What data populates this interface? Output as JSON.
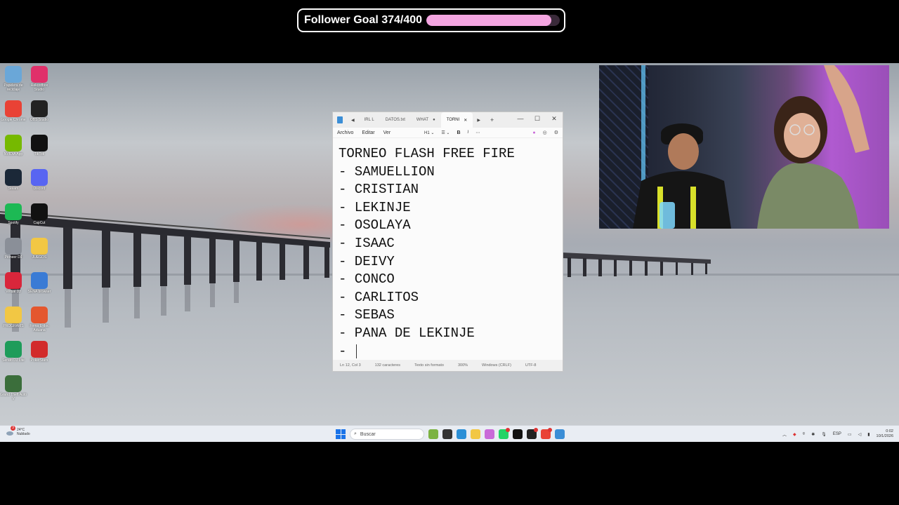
{
  "overlay": {
    "follower_label": "Follower Goal 374/400",
    "current": 374,
    "goal": 400,
    "fill_color": "#f3a4e0"
  },
  "desktop_icons": [
    {
      "label": "Papelera de reciclaje",
      "icon": "recycle-bin-icon",
      "color": "#6aa7d8"
    },
    {
      "label": "Rekordbox Studio",
      "icon": "music-app-icon",
      "color": "#e0306a"
    },
    {
      "label": "Google Chrome",
      "icon": "chrome-icon",
      "color": "#e94235"
    },
    {
      "label": "OBS Studio",
      "icon": "obs-icon",
      "color": "#222222"
    },
    {
      "label": "NVIDIA App",
      "icon": "nvidia-icon",
      "color": "#76b900"
    },
    {
      "label": "TikTok",
      "icon": "tiktok-icon",
      "color": "#111111"
    },
    {
      "label": "Steam",
      "icon": "steam-icon",
      "color": "#1b2838"
    },
    {
      "label": "Discord",
      "icon": "discord-icon",
      "color": "#5865f2"
    },
    {
      "label": "Spotify",
      "icon": "spotify-icon",
      "color": "#1db954"
    },
    {
      "label": "CapCut",
      "icon": "capcut-icon",
      "color": "#111111"
    },
    {
      "label": "Pioneer DJ",
      "icon": "pioneer-icon",
      "color": "#8a8f98"
    },
    {
      "label": "JUEGOS",
      "icon": "folder-icon",
      "color": "#f2c744"
    },
    {
      "label": "Virtual DJ",
      "icon": "virtualdj-icon",
      "color": "#d9263b"
    },
    {
      "label": "SENA browser",
      "icon": "sena-icon",
      "color": "#3a7bd5"
    },
    {
      "label": "PROGRAMS",
      "icon": "folder-icon",
      "color": "#f2c744"
    },
    {
      "label": "Firma E-doc Aduana",
      "icon": "firma-icon",
      "color": "#e4572e"
    },
    {
      "label": "Serato DJ Lite",
      "icon": "serato-icon",
      "color": "#1e9c5a"
    },
    {
      "label": "PokerStars",
      "icon": "pokerstars-icon",
      "color": "#d22b2b"
    },
    {
      "label": "Grand Theft Auto V",
      "icon": "gta-icon",
      "color": "#3b6e3b"
    }
  ],
  "notepad": {
    "tabs": [
      {
        "label": "IRL L",
        "active": false
      },
      {
        "label": "DATOS.txt",
        "active": false
      },
      {
        "label": "WHAT",
        "active": false
      },
      {
        "label": "TORNI",
        "active": true
      }
    ],
    "menu": {
      "archivo": "Archivo",
      "editar": "Editar",
      "ver": "Ver"
    },
    "format": {
      "heading": "H1",
      "bold": "B",
      "italic": "I"
    },
    "lines": [
      "TORNEO FLASH FREE FIRE",
      "- SAMUELLION",
      "- CRISTIAN",
      "- LEKINJE",
      "- OSOLAYA",
      "- ISAAC",
      "- DEIVY",
      "- CONCO",
      "- CARLITOS",
      "- SEBAS",
      "- PANA DE LEKINJE",
      "- "
    ],
    "status": {
      "position": "Ln 12, Col 3",
      "chars": "132 caracteres",
      "format": "Texto sin formato",
      "zoom": "300%",
      "eol": "Windows (CRLF)",
      "encoding": "UTF-8"
    }
  },
  "taskbar": {
    "weather_temp": "24°C",
    "weather_desc": "Nublado",
    "weather_badge": "3",
    "search_placeholder": "Buscar",
    "apps": [
      {
        "icon": "widgets-icon",
        "color": "#7cb342"
      },
      {
        "icon": "task-view-icon",
        "color": "#333333"
      },
      {
        "icon": "edge-icon",
        "color": "#2b8fd6"
      },
      {
        "icon": "file-explorer-icon",
        "color": "#f2c744"
      },
      {
        "icon": "copilot-icon",
        "color": "#c96ad8"
      },
      {
        "icon": "whatsapp-icon",
        "color": "#25d366",
        "badge": true
      },
      {
        "icon": "tiktok-icon",
        "color": "#111111"
      },
      {
        "icon": "obs-icon",
        "color": "#222222",
        "badge": true
      },
      {
        "icon": "chrome-icon",
        "color": "#e94235",
        "badge": true
      },
      {
        "icon": "notepad-icon",
        "color": "#3b8ed6"
      }
    ],
    "language": "ESP",
    "time": "0:02",
    "date": "10/1/2026"
  }
}
